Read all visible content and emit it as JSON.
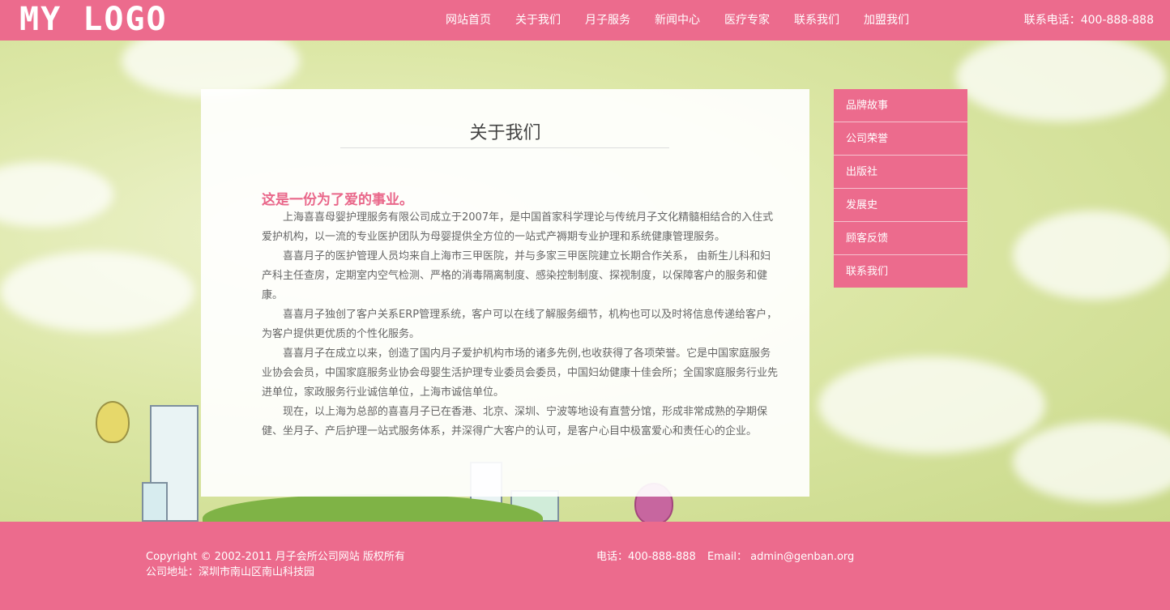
{
  "header": {
    "logo": "MY LOGO",
    "nav": [
      "网站首页",
      "关于我们",
      "月子服务",
      "新闻中心",
      "医疗专家",
      "联系我们",
      "加盟我们"
    ],
    "hotline": "联系电话：400-888-888"
  },
  "content": {
    "title": "关于我们",
    "slogan": "这是一份为了爱的事业。",
    "paragraphs": [
      "上海喜喜母婴护理服务有限公司成立于2007年，是中国首家科学理论与传统月子文化精髓相结合的入住式爱护机构，以一流的专业医护团队为母婴提供全方位的一站式产褥期专业护理和系统健康管理服务。",
      "喜喜月子的医护管理人员均来自上海市三甲医院，并与多家三甲医院建立长期合作关系， 由新生儿科和妇产科主任查房，定期室内空气检测、严格的消毒隔离制度、感染控制制度、探视制度，以保障客户的服务和健康。",
      "喜喜月子独创了客户关系ERP管理系统，客户可以在线了解服务细节，机构也可以及时将信息传递给客户，为客户提供更优质的个性化服务。",
      "喜喜月子在成立以来，创造了国内月子爱护机构市场的诸多先例,也收获得了各项荣誉。它是中国家庭服务业协会会员，中国家庭服务业协会母婴生活护理专业委员会委员，中国妇幼健康十佳会所；全国家庭服务行业先进单位，家政服务行业诚信单位，上海市诚信单位。",
      "现在，以上海为总部的喜喜月子已在香港、北京、深圳、宁波等地设有直营分馆，形成非常成熟的孕期保健、坐月子、产后护理一站式服务体系，并深得广大客户的认可，是客户心目中极富爱心和责任心的企业。"
    ]
  },
  "side_menu": [
    "品牌故事",
    "公司荣誉",
    "出版社",
    "发展史",
    "顾客反馈",
    "联系我们"
  ],
  "footer": {
    "copyright": "Copyright © 2002-2011 月子会所公司网站 版权所有",
    "address": "公司地址：深圳市南山区南山科技园",
    "phone": "电话：400-888-888",
    "email": "Email： admin@genban.org"
  },
  "colors": {
    "brand_pink": "#ec6b8d",
    "slogan_pink": "#e9678a",
    "background_green": "#d6e29a"
  }
}
